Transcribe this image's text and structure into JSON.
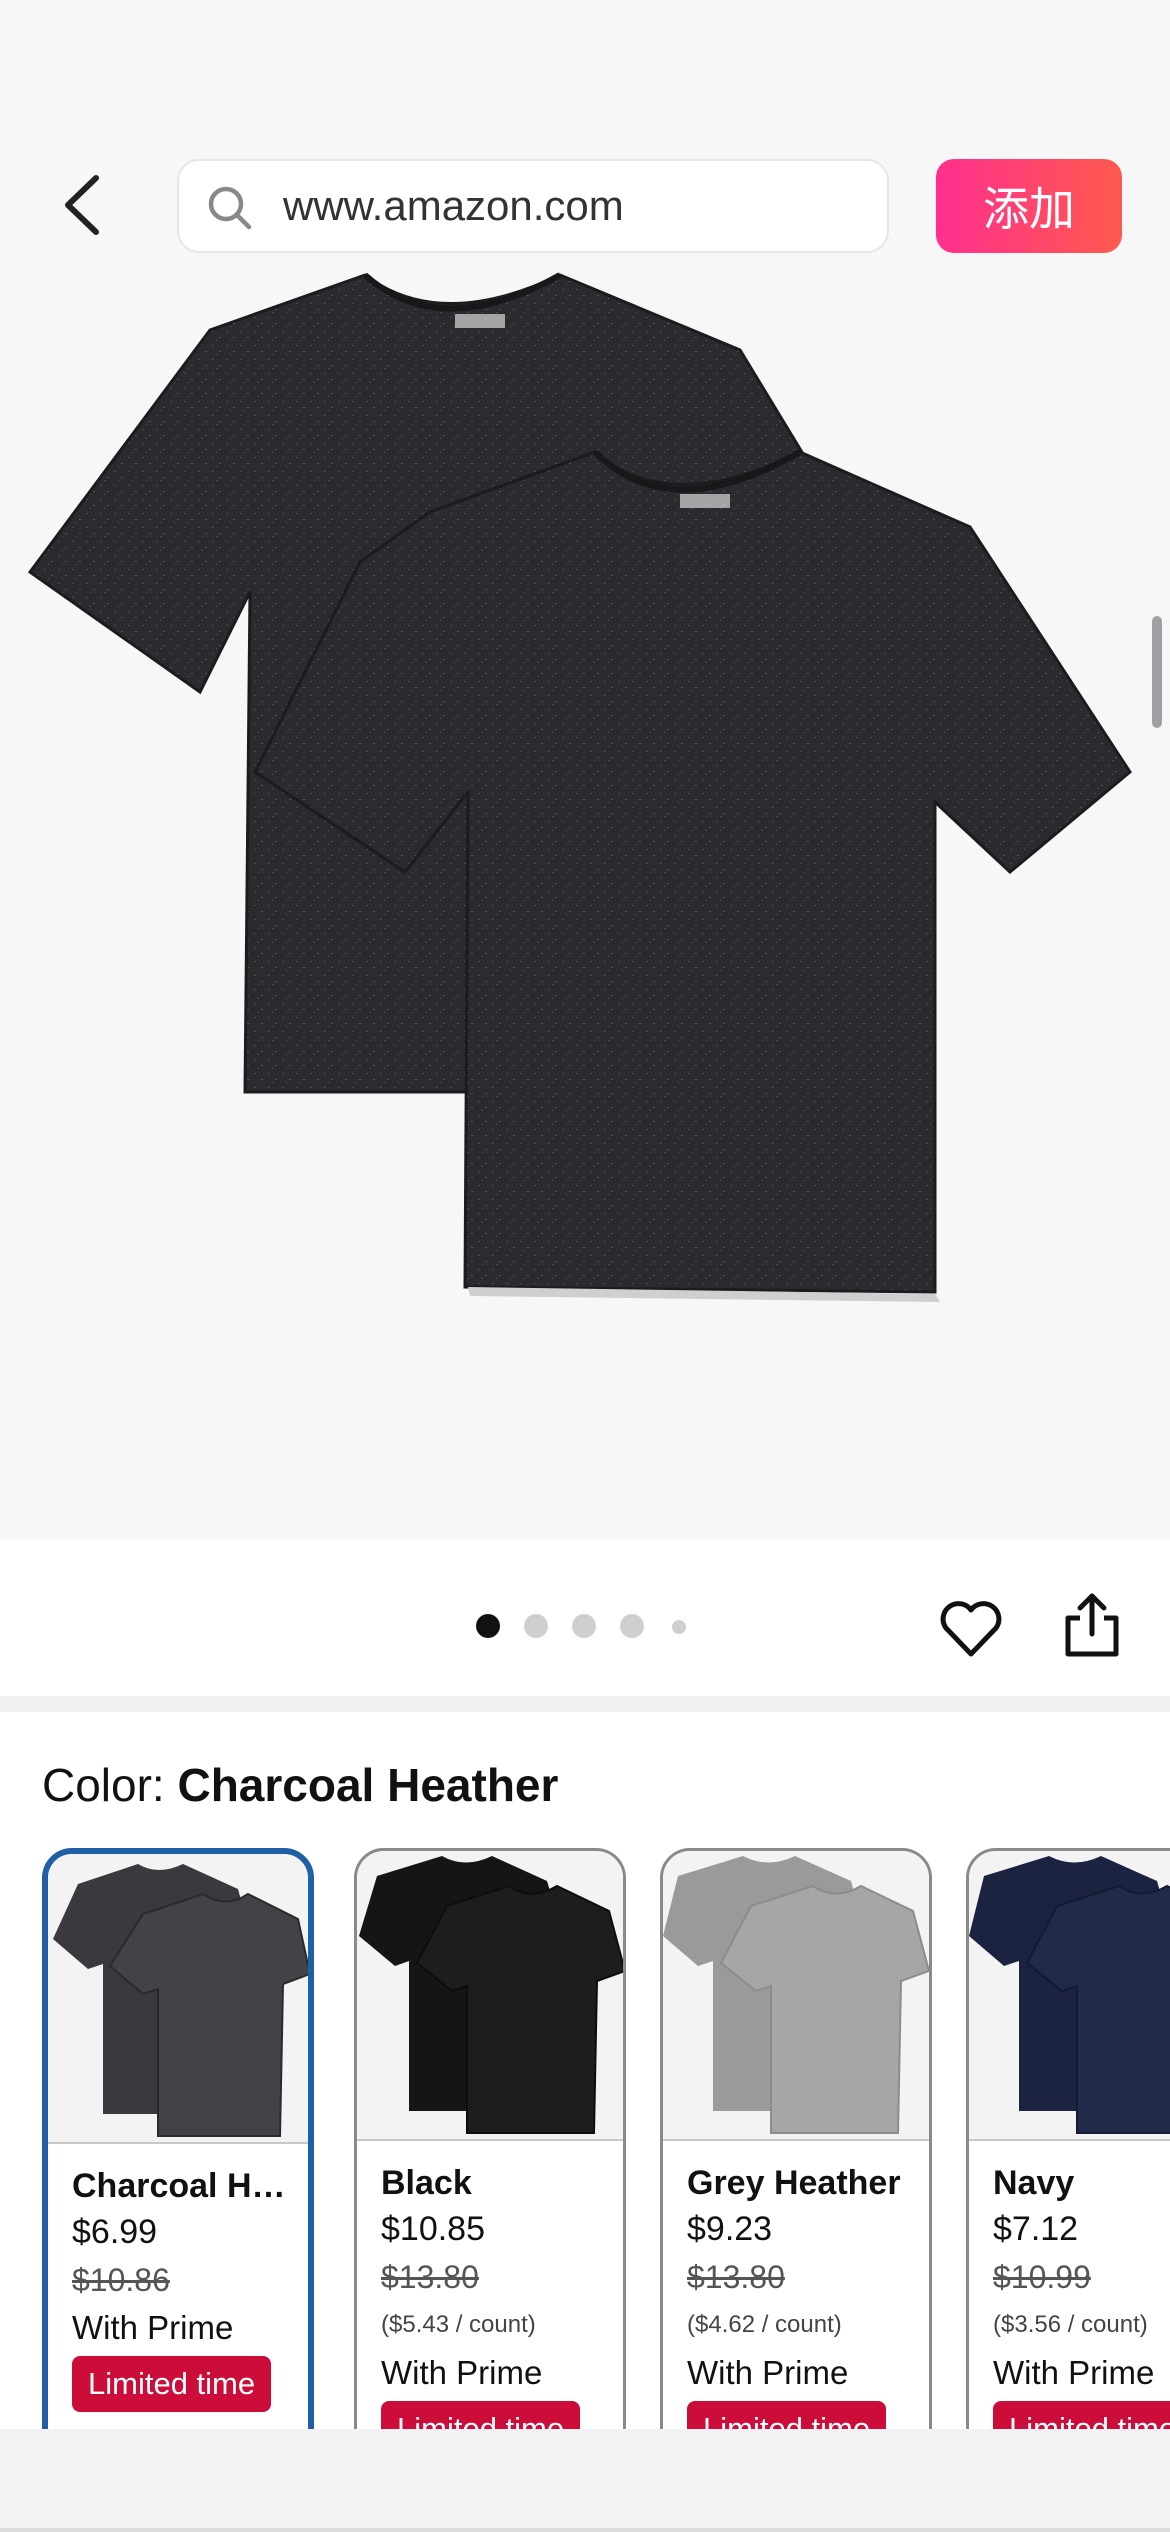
{
  "browser": {
    "url": "www.amazon.com",
    "add_label": "添加"
  },
  "gallery": {
    "dot_count": 5,
    "active_dot": 0
  },
  "color": {
    "label": "Color: ",
    "selected": "Charcoal Heather"
  },
  "swatches": [
    {
      "name": "Charcoal He...",
      "price": "$6.99",
      "old_price": "$10.86",
      "unit": "",
      "prime": "With Prime",
      "badge": "Limited time",
      "shirt_color": "#3a393d"
    },
    {
      "name": "Black",
      "price": "$10.85",
      "old_price": "$13.80",
      "unit": "($5.43 / count)",
      "prime": "With Prime",
      "badge": "Limited time",
      "shirt_color": "#151515"
    },
    {
      "name": "Grey Heather",
      "price": "$9.23",
      "old_price": "$13.80",
      "unit": "($4.62 / count)",
      "prime": "With Prime",
      "badge": "Limited time",
      "shirt_color": "#9a9a9c"
    },
    {
      "name": "Navy",
      "price": "$7.12",
      "old_price": "$10.99",
      "unit": "($3.56 / count)",
      "prime": "With Prime",
      "badge": "Limited time",
      "shirt_color": "#1c2340"
    }
  ],
  "colors": {
    "add_gradient_start": "#ff2f8e",
    "add_gradient_end": "#ff5a4e",
    "selected_border": "#1f5fa6",
    "badge_red": "#cc0c39"
  }
}
